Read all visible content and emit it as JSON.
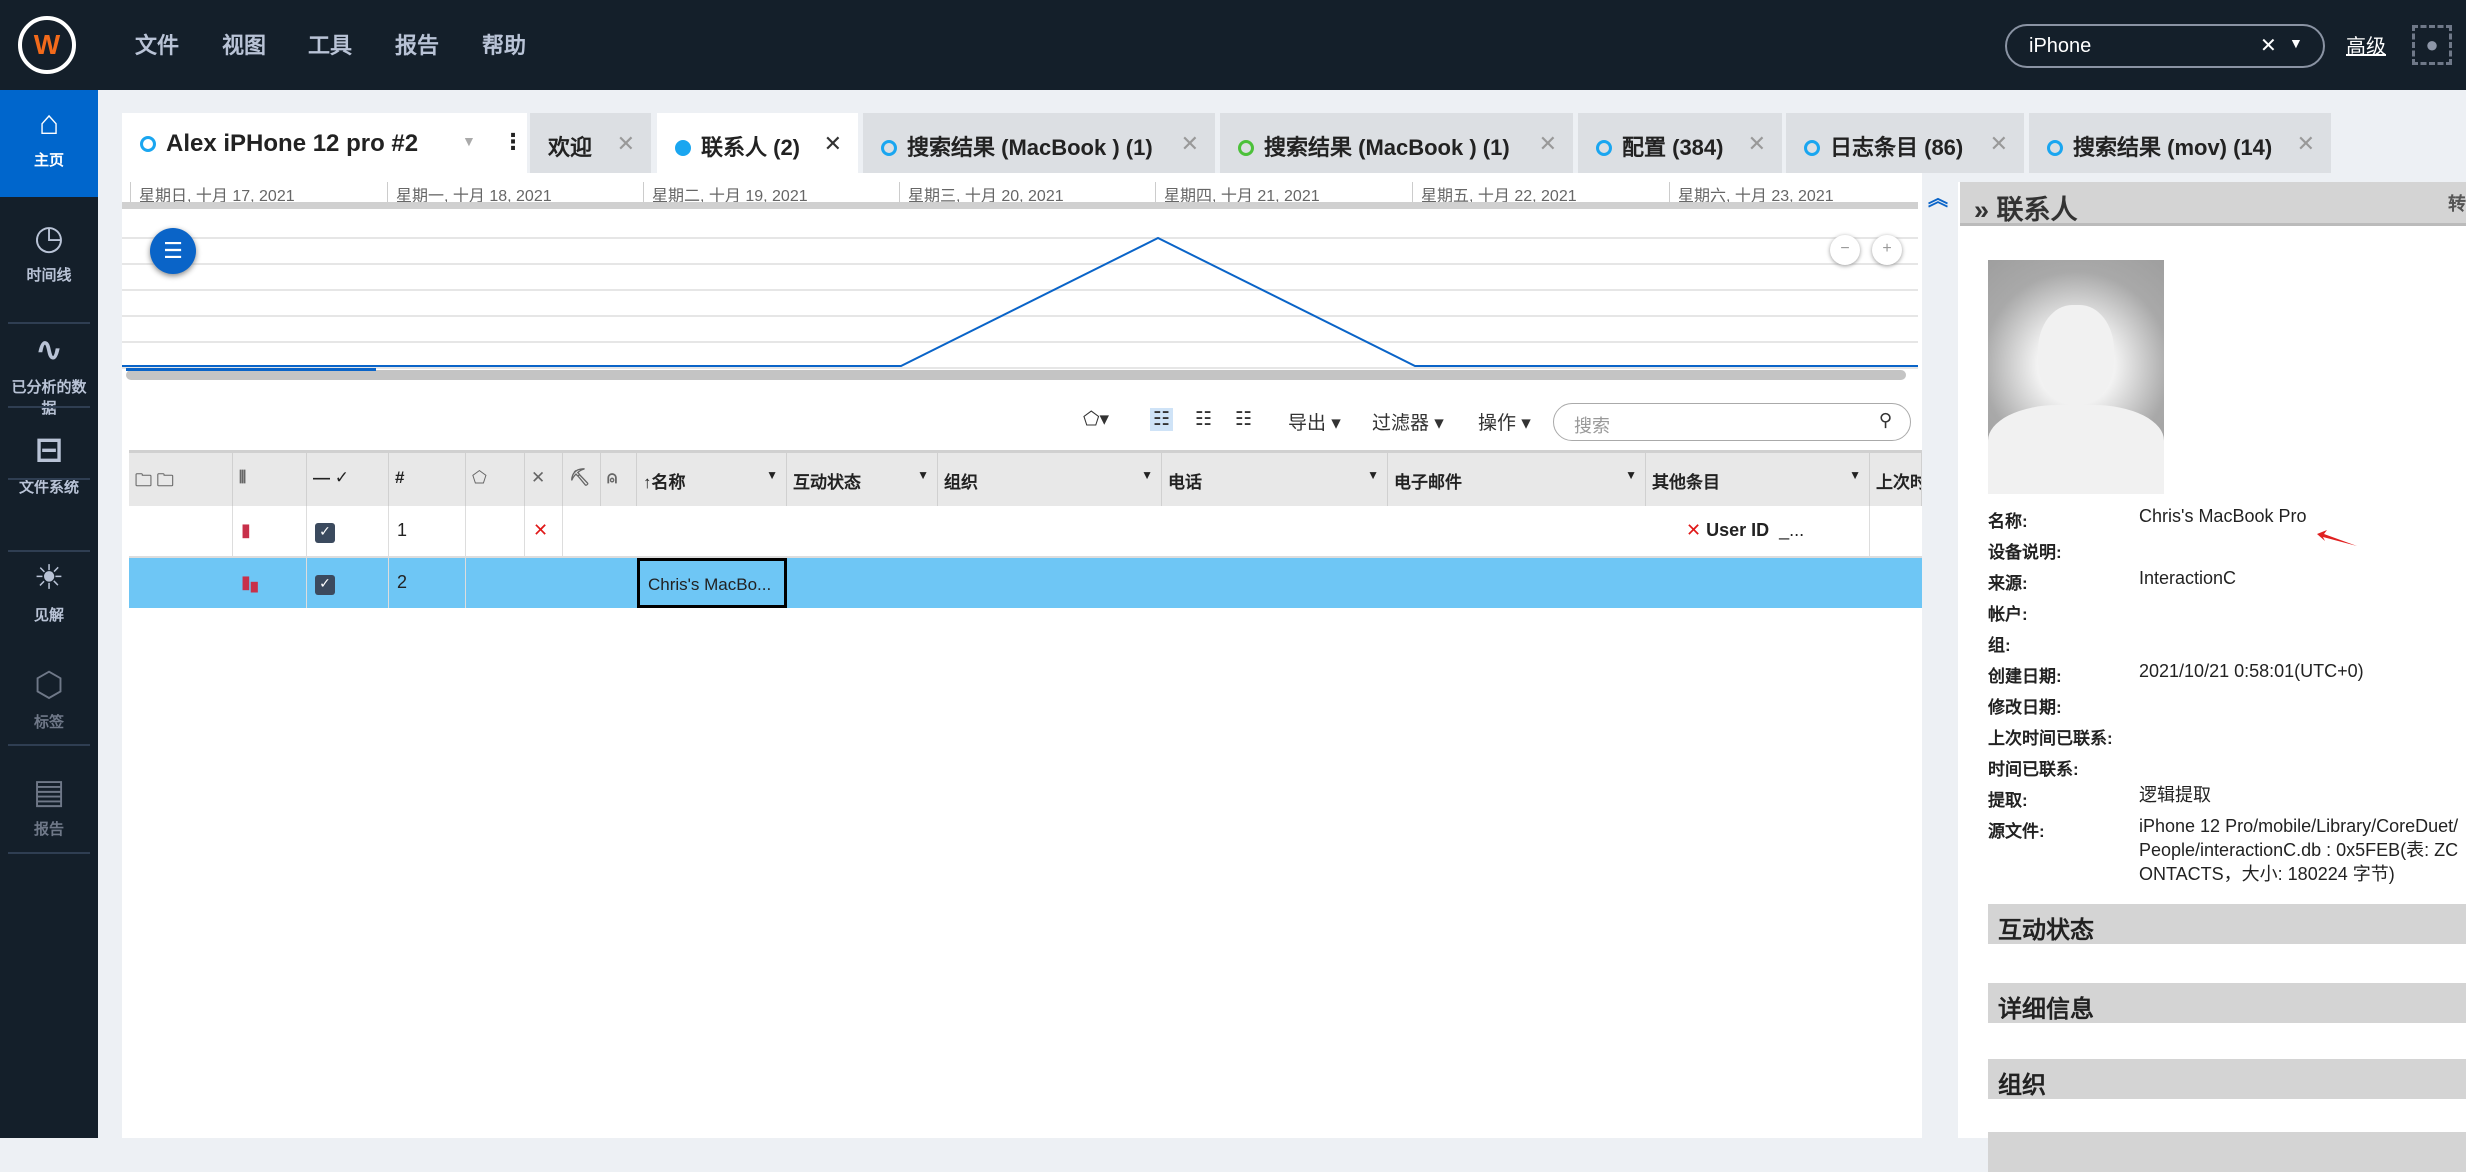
{
  "menu": [
    "文件",
    "视图",
    "工具",
    "报告",
    "帮助"
  ],
  "search": {
    "value": "iPhone",
    "advanced": "高级"
  },
  "sidebar": [
    "主页",
    "时间线",
    "已分析的数据",
    "文件系统",
    "见解",
    "标签",
    "报告"
  ],
  "tabs": [
    {
      "label": "Alex iPHone 12 pro #2"
    },
    {
      "label": "欢迎"
    },
    {
      "label": "联系人 (2)"
    },
    {
      "label": "搜索结果 (MacBook ) (1)"
    },
    {
      "label": "搜索结果 (MacBook ) (1)"
    },
    {
      "label": "配置 (384)"
    },
    {
      "label": "日志条目 (86)"
    },
    {
      "label": "搜索结果 (mov) (14)"
    }
  ],
  "timeline": {
    "dates": [
      "星期日, 十月 17, 2021",
      "星期一, 十月 18, 2021",
      "星期二, 十月 19, 2021",
      "星期三, 十月 20, 2021",
      "星期四, 十月 21, 2021",
      "星期五, 十月 22, 2021",
      "星期六, 十月 23, 2021"
    ],
    "counts": [
      0,
      0,
      0,
      0,
      1,
      0,
      0
    ],
    "accent": "#0a64c8"
  },
  "toolbar": {
    "export": "导出",
    "filter": "过滤器",
    "actions": "操作",
    "search_placeholder": "搜索"
  },
  "columns": [
    "#",
    "↑名称",
    "互动状态",
    "组织",
    "电话",
    "电子邮件",
    "其他条目",
    "上次时"
  ],
  "rows": [
    {
      "num": "1",
      "name": "",
      "other": "User ID",
      "other2": "_..."
    },
    {
      "num": "2",
      "name": "Chris's MacBo...",
      "other": "",
      "other2": ""
    }
  ],
  "panel": {
    "title": "联系人",
    "cut": "转",
    "fields": [
      {
        "label": "名称:",
        "value": "Chris's MacBook Pro"
      },
      {
        "label": "设备说明:",
        "value": ""
      },
      {
        "label": "来源:",
        "value": "InteractionC"
      },
      {
        "label": "帐户:",
        "value": ""
      },
      {
        "label": "组:",
        "value": ""
      },
      {
        "label": "创建日期:",
        "value": "2021/10/21 0:58:01(UTC+0)"
      },
      {
        "label": "修改日期:",
        "value": ""
      },
      {
        "label": "上次时间已联系:",
        "value": ""
      },
      {
        "label": "时间已联系:",
        "value": ""
      },
      {
        "label": "提取:",
        "value": "逻辑提取"
      },
      {
        "label": "源文件:",
        "value": "iPhone 12 Pro/mobile/Library/CoreDuet/People/interactionC.db : 0x5FEB(表: ZCONTACTS，大小: 180224 字节)"
      }
    ],
    "sections": [
      "互动状态",
      "详细信息",
      "组织"
    ]
  }
}
